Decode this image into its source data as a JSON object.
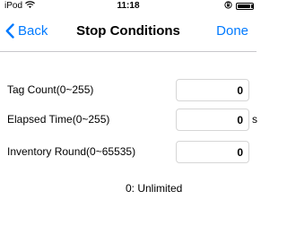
{
  "status_bar": {
    "carrier": "iPod",
    "time": "11:18",
    "icons": [
      "wifi-icon",
      "orientation-lock-icon",
      "battery-icon"
    ],
    "battery_level": 0.85
  },
  "nav": {
    "back_label": "Back",
    "title": "Stop Conditions",
    "done_label": "Done"
  },
  "fields": [
    {
      "label": "Tag Count(0~255)",
      "value": "0",
      "unit": ""
    },
    {
      "label": "Elapsed Time(0~255)",
      "value": "0",
      "unit": "s"
    },
    {
      "label": "Inventory Round(0~65535)",
      "value": "0",
      "unit": ""
    }
  ],
  "hint": "0: Unlimited",
  "colors": {
    "accent": "#007aff",
    "separator": "#c8c7cc",
    "input_border": "#d6d6d6"
  }
}
